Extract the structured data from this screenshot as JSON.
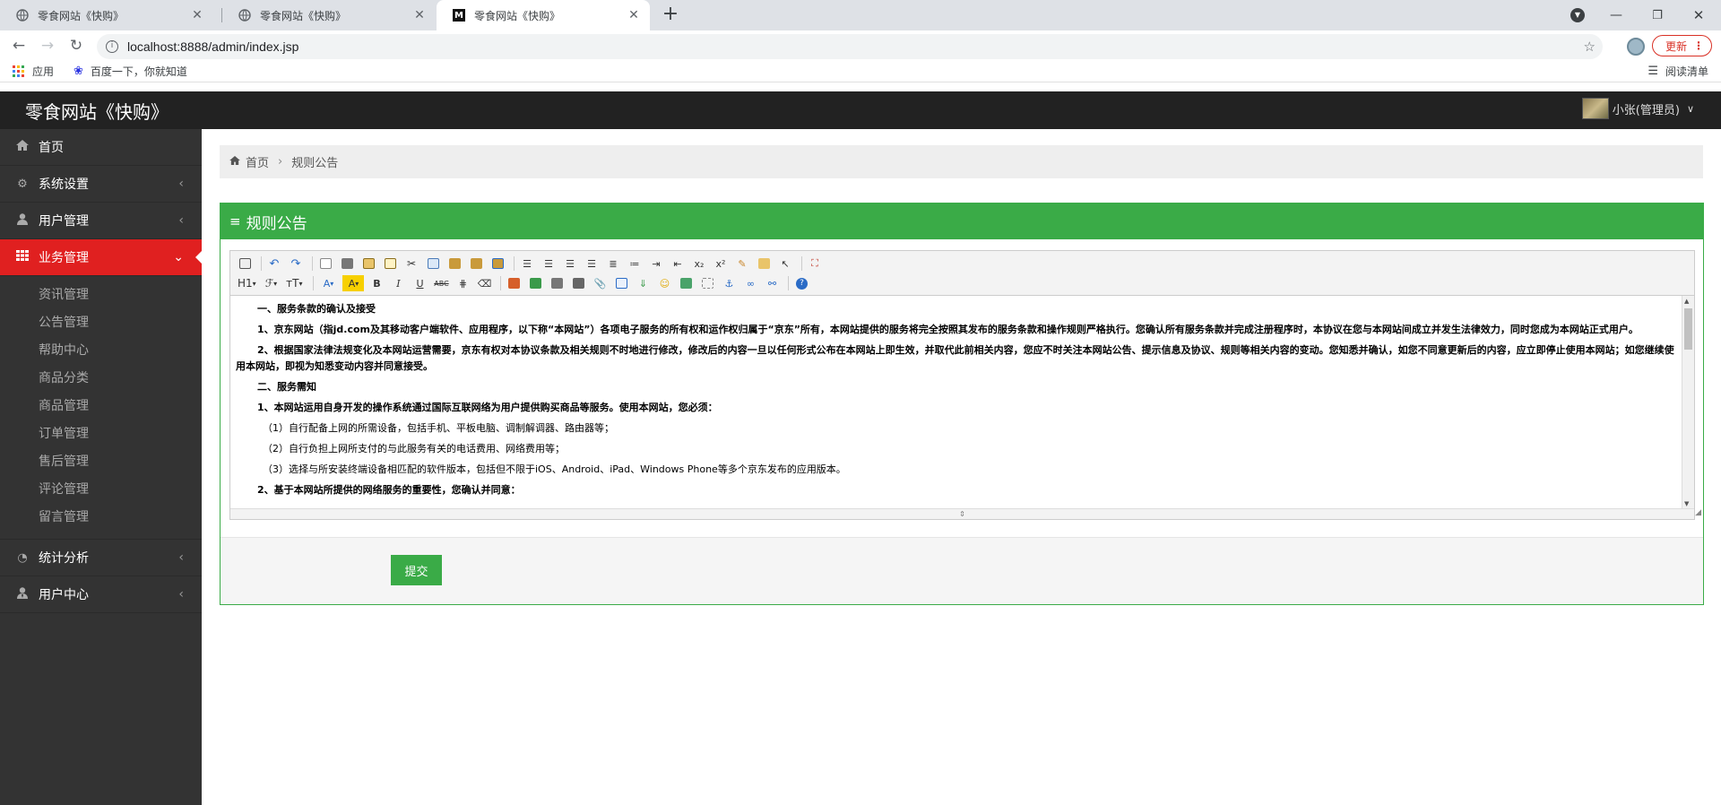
{
  "browser": {
    "tabs": [
      {
        "title": "零食网站《快购》",
        "favicon": "globe-icon",
        "active": false
      },
      {
        "title": "零食网站《快购》",
        "favicon": "globe-icon",
        "active": false
      },
      {
        "title": "零食网站《快购》",
        "favicon": "m-icon",
        "active": true
      }
    ],
    "url": "localhost:8888/admin/index.jsp",
    "update_label": "更新",
    "bookmarks": [
      {
        "label": "应用",
        "icon": "apps-grid-icon"
      },
      {
        "label": "百度一下，你就知道",
        "icon": "baidu-paw-icon"
      }
    ],
    "reading_list": "阅读清单"
  },
  "app": {
    "brand": "零食网站《快购》",
    "user": "小张(管理员)",
    "accent_color": "#3aab47",
    "active_nav_color": "#e02020"
  },
  "sidebar": {
    "items": [
      {
        "label": "首页",
        "icon": "home-icon"
      },
      {
        "label": "系统设置",
        "icon": "gears-icon"
      },
      {
        "label": "用户管理",
        "icon": "user-icon"
      },
      {
        "label": "业务管理",
        "icon": "grid-icon"
      },
      {
        "label": "统计分析",
        "icon": "dashboard-icon"
      },
      {
        "label": "用户中心",
        "icon": "user-tie-icon"
      }
    ],
    "subitems": [
      "资讯管理",
      "公告管理",
      "帮助中心",
      "商品分类",
      "商品管理",
      "订单管理",
      "售后管理",
      "评论管理",
      "留言管理"
    ]
  },
  "breadcrumb": {
    "home": "首页",
    "current": "规则公告"
  },
  "panel": {
    "title": "规则公告"
  },
  "editor": {
    "toolbar": {
      "heading": "H1",
      "font": "ℱ",
      "size": "тT"
    },
    "paragraphs": [
      "一、服务条款的确认及接受",
      "1、京东网站（指jd.com及其移动客户端软件、应用程序，以下称“本网站”）各项电子服务的所有权和运作权归属于“京东”所有，本网站提供的服务将完全按照其发布的服务条款和操作规则严格执行。您确认所有服务条款并完成注册程序时，本协议在您与本网站间成立并发生法律效力，同时您成为本网站正式用户。",
      "2、根据国家法律法规变化及本网站运营需要，京东有权对本协议条款及相关规则不时地进行修改，修改后的内容一旦以任何形式公布在本网站上即生效，并取代此前相关内容，您应不时关注本网站公告、提示信息及协议、规则等相关内容的变动。您知悉并确认，如您不同意更新后的内容，应立即停止使用本网站；如您继续使用本网站，即视为知悉变动内容并同意接受。",
      "二、服务需知",
      "1、本网站运用自身开发的操作系统通过国际互联网络为用户提供购买商品等服务。使用本网站，您必须：",
      "（1）自行配备上网的所需设备，包括手机、平板电脑、调制解调器、路由器等；",
      "（2）自行负担上网所支付的与此服务有关的电话费用、网络费用等；",
      "（3）选择与所安装终端设备相匹配的软件版本，包括但不限于iOS、Android、iPad、Windows Phone等多个京东发布的应用版本。",
      "2、基于本网站所提供的网络服务的重要性，您确认并同意："
    ]
  },
  "submit_label": "提交"
}
